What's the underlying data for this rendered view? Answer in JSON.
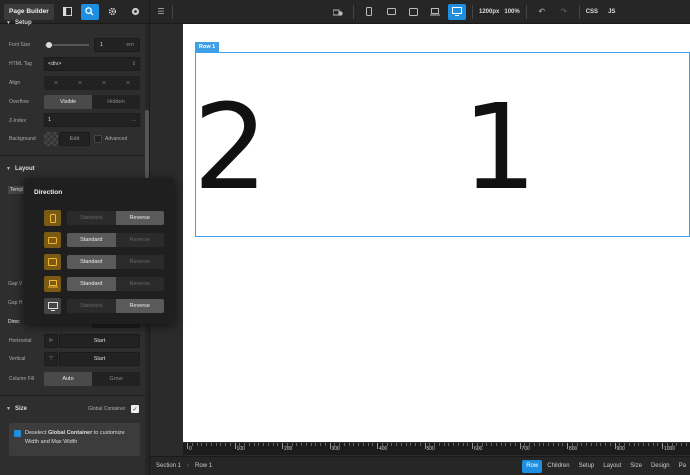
{
  "sidebar": {
    "page_builder": "Page Builder",
    "setup_title": "Setup",
    "font_size": {
      "label": "Font Size",
      "value": "1",
      "unit": "em",
      "slider": 0.1
    },
    "html_tag": {
      "label": "HTML Tag",
      "value": "<div>"
    },
    "align": {
      "label": "Align"
    },
    "overflow": {
      "label": "Overflow",
      "opt1": "Visible",
      "opt2": "Hidden"
    },
    "zindex": {
      "label": "Z-Index",
      "value": "1",
      "more": "..."
    },
    "background": {
      "label": "Background",
      "edit": "Edit",
      "advanced": "Advanced"
    },
    "layout_title": "Layout",
    "template_label": "Templ",
    "gap_v_label": "Gap V",
    "gap_h_label": "Gap H",
    "direction_label": "Direc",
    "horizontal": {
      "label": "Horizontal",
      "value": "Start"
    },
    "vertical": {
      "label": "Vertical",
      "value": "Start"
    },
    "column_fill": {
      "label": "Column Fill",
      "opt1": "Auto",
      "opt2": "Grow"
    },
    "size_title": "Size",
    "global_container_label": "Global Container",
    "size_msg_1": "Deselect ",
    "size_msg_bold": "Global Container",
    "size_msg_2": " to customize Width and Max Width"
  },
  "toolbar": {
    "width_value": "1200px",
    "zoom": "100%",
    "css": "CSS",
    "js": "JS"
  },
  "direction_popup": {
    "title": "Direction",
    "standard": "Standard",
    "reverse": "Reverse",
    "rows": [
      {
        "device": "phone",
        "selected": "reverse"
      },
      {
        "device": "phone-landscape",
        "selected": "standard"
      },
      {
        "device": "tablet",
        "selected": "standard"
      },
      {
        "device": "laptop",
        "selected": "standard"
      },
      {
        "device": "desktop",
        "selected": "reverse"
      }
    ]
  },
  "canvas": {
    "row_tag": "Row 1",
    "num_left": "2",
    "num_right": "1"
  },
  "ruler": [
    "0",
    "100",
    "200",
    "300",
    "400",
    "500",
    "600",
    "700",
    "800",
    "900",
    "1000"
  ],
  "bottombar": {
    "crumb1": "Section 1",
    "crumb2": "Row 1",
    "tabs": [
      "Row",
      "Children",
      "Setup",
      "Layout",
      "Size",
      "Design",
      "Pa"
    ]
  },
  "colors": {
    "accent": "#1e8fe0",
    "row_outline": "#3fa0e8",
    "device_icon": "#f2b632"
  }
}
